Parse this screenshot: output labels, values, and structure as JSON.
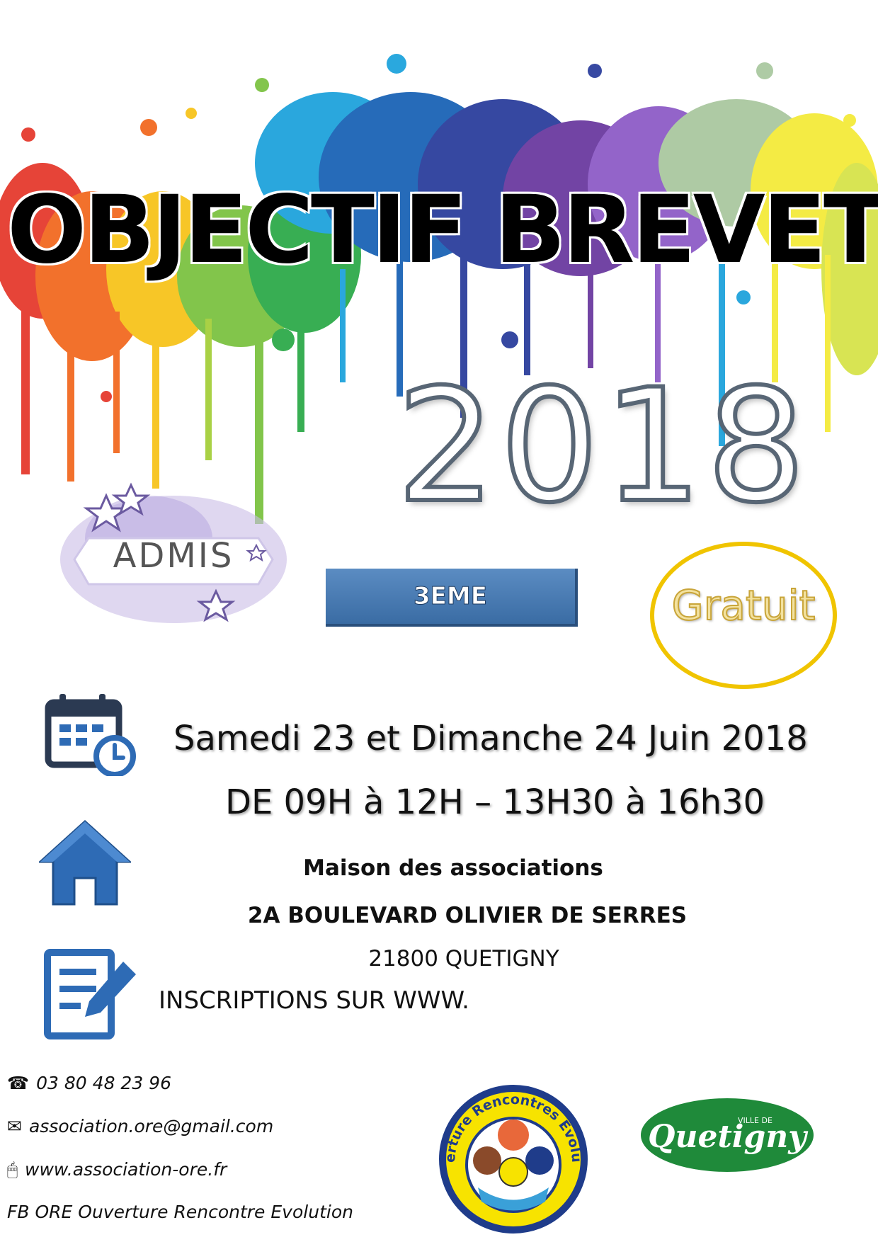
{
  "poster": {
    "title": "OBJECTIF BREVET",
    "year": "2018",
    "badge": "ADMIS",
    "level": "3EME",
    "price": "Gratuit",
    "dates": "Samedi 23 et  Dimanche 24 Juin 2018",
    "hours": "DE 09H à 12H – 13H30 à 16h30",
    "venue_name": "Maison des associations",
    "venue_street": "2A BOULEVARD OLIVIER DE SERRES",
    "venue_city": "21800 QUETIGNY",
    "signup": "INSCRIPTIONS SUR WWW."
  },
  "contacts": {
    "phone": "03 80 48 23 96",
    "email": "association.ore@gmail.com",
    "website": "www.association-ore.fr",
    "facebook": "FB ORE Ouverture Rencontre Evolution"
  },
  "logos": {
    "ore": "Ouverture Rencontres Evolution",
    "city_small": "VILLE DE",
    "city": "Quetigny"
  },
  "colors": {
    "level_box": "#3f72ab",
    "price_ring": "#f0c400",
    "icon_blue": "#2e6bb5",
    "city_green": "#1f8a3a"
  },
  "icons": [
    "calendar-clock-icon",
    "home-icon",
    "form-edit-icon",
    "phone-icon",
    "mail-icon",
    "mouse-icon"
  ]
}
